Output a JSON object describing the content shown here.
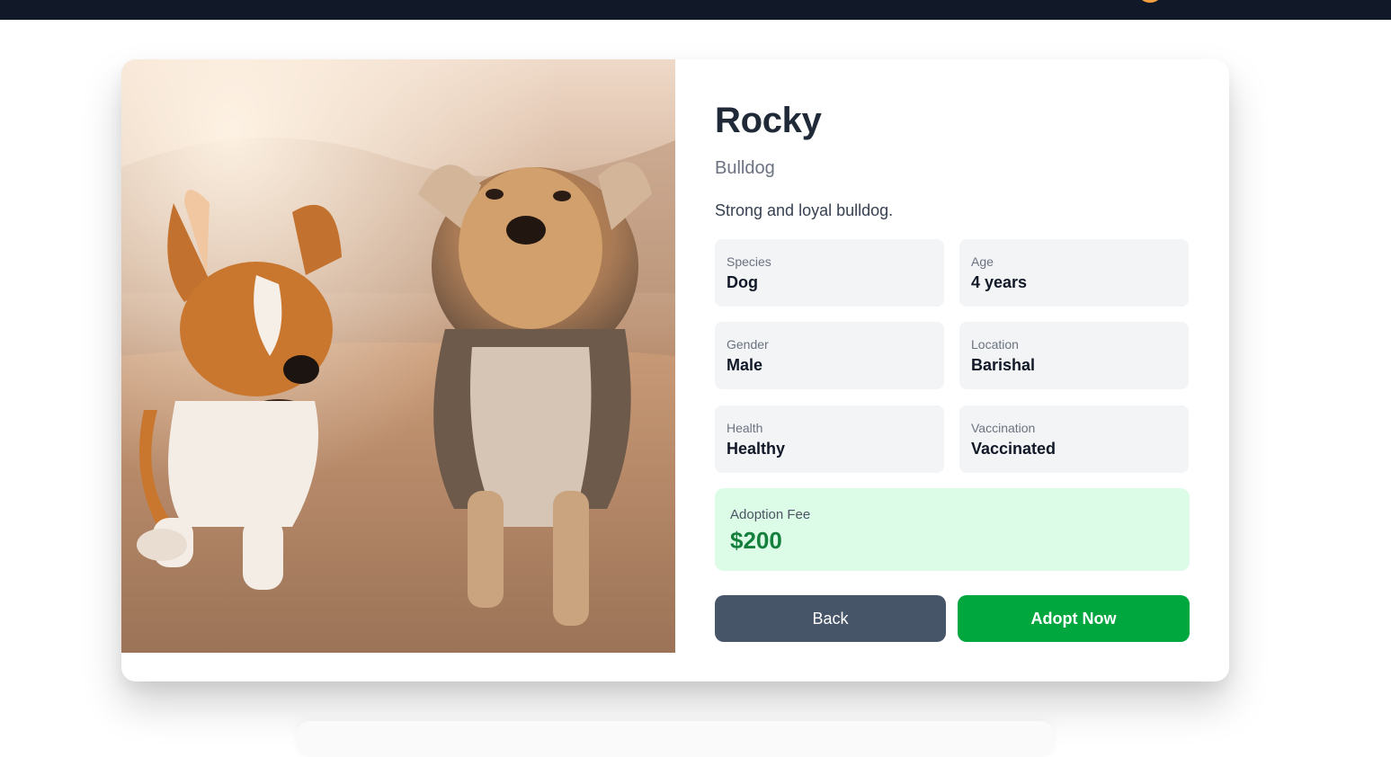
{
  "pet": {
    "name": "Rocky",
    "breed": "Bulldog",
    "description": "Strong and loyal bulldog.",
    "photo_icon": "pet-photo-icon"
  },
  "stats": [
    {
      "label": "Species",
      "value": "Dog"
    },
    {
      "label": "Age",
      "value": "4 years"
    },
    {
      "label": "Gender",
      "value": "Male"
    },
    {
      "label": "Location",
      "value": "Barishal"
    },
    {
      "label": "Health",
      "value": "Healthy"
    },
    {
      "label": "Vaccination",
      "value": "Vaccinated"
    }
  ],
  "fee": {
    "label": "Adoption Fee",
    "value": "$200"
  },
  "actions": {
    "back_label": "Back",
    "adopt_label": "Adopt Now"
  },
  "colors": {
    "navbar": "#111827",
    "back_button": "#475569",
    "adopt_button": "#00a63e",
    "fee_background": "#dcfce7",
    "fee_text": "#15803d"
  }
}
